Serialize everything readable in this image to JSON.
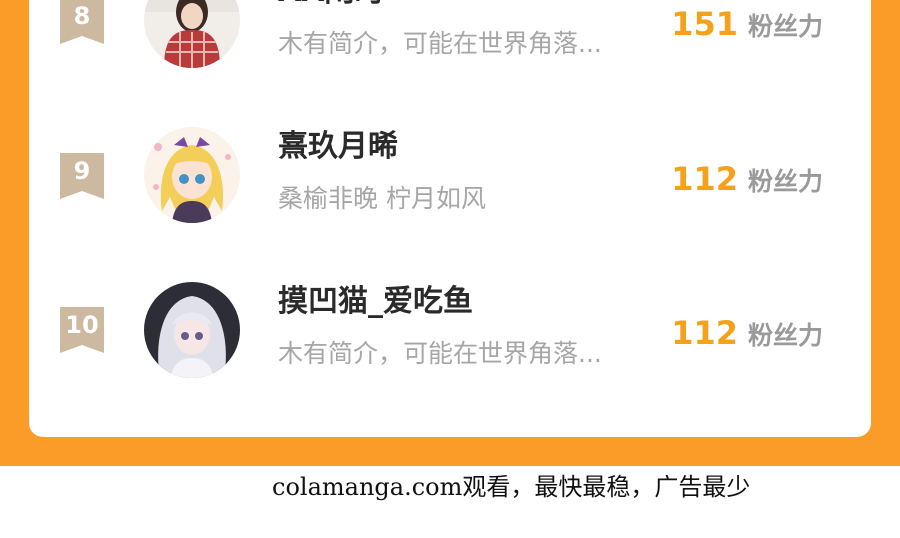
{
  "ranking": {
    "entries": [
      {
        "rank": "8",
        "name": "AA闲时",
        "bio": "木有简介，可能在世界角落...",
        "fans": "151",
        "fans_label": "粉丝力"
      },
      {
        "rank": "9",
        "name": "熹玖月晞",
        "bio": "桑榆非晚 柠月如风",
        "fans": "112",
        "fans_label": "粉丝力"
      },
      {
        "rank": "10",
        "name": "摸凹猫_爱吃鱼",
        "bio": "木有简介，可能在世界角落...",
        "fans": "112",
        "fans_label": "粉丝力"
      }
    ]
  },
  "footer": {
    "watermark": "colamanga.com观看，最快最稳，广告最少"
  },
  "colors": {
    "background": "#fb9b28",
    "fans_number": "#f5a21a",
    "rank_badge": "#cdb8a0",
    "card": "#ffffff"
  }
}
